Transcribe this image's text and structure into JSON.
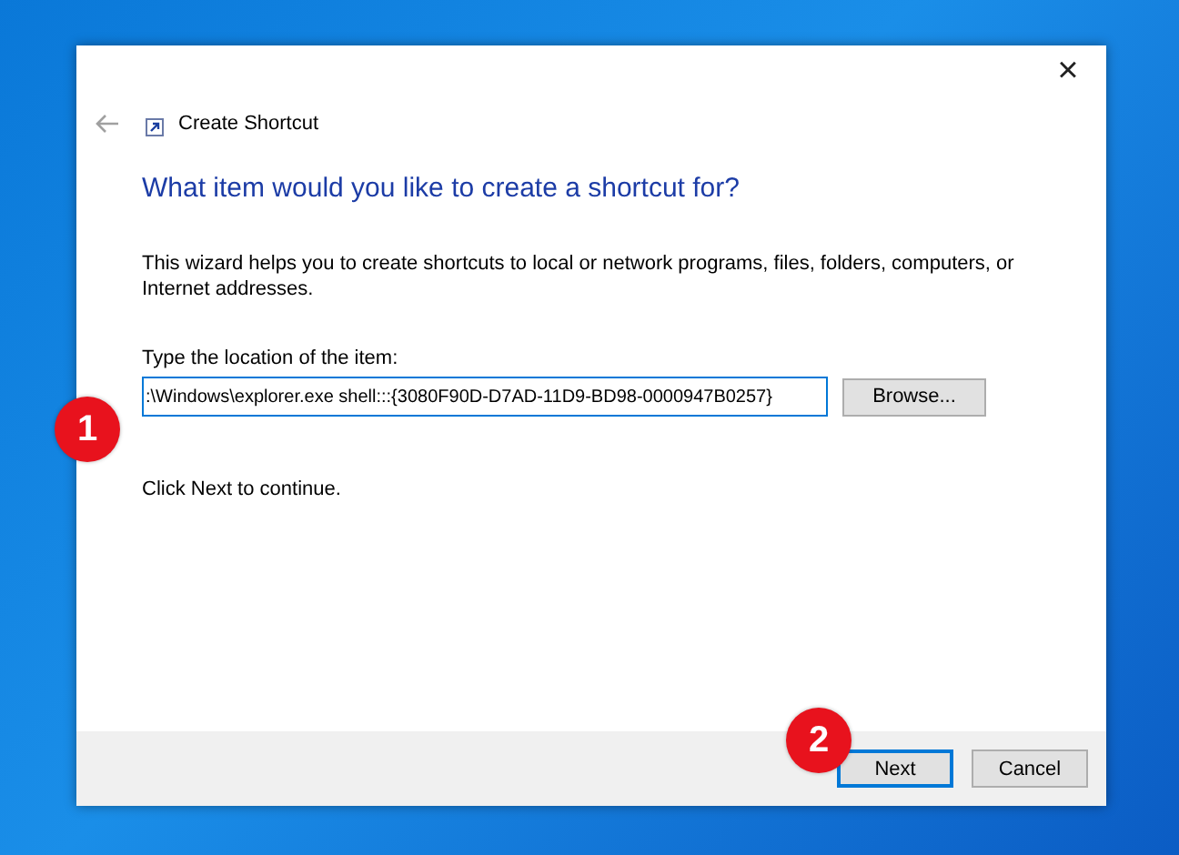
{
  "window": {
    "title": "Create Shortcut",
    "close": "×"
  },
  "heading": "What item would you like to create a shortcut for?",
  "description": "This wizard helps you to create shortcuts to local or network programs, files, folders, computers, or Internet addresses.",
  "location": {
    "label": "Type the location of the item:",
    "value": ":\\Windows\\explorer.exe shell:::{3080F90D-D7AD-11D9-BD98-0000947B0257}",
    "focused": true,
    "browse": "Browse..."
  },
  "hint": "Click Next to continue.",
  "buttons": [
    {
      "label": "Next",
      "default": true
    },
    {
      "label": "Cancel",
      "default": false
    }
  ],
  "callouts": [
    {
      "label": "1"
    },
    {
      "label": "2"
    }
  ]
}
